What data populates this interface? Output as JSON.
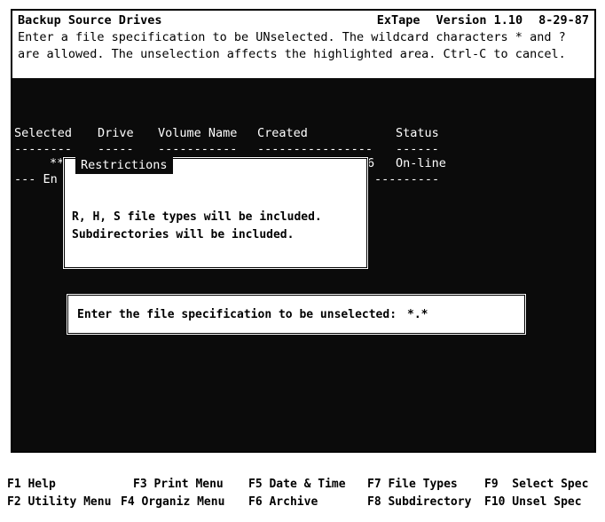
{
  "title": {
    "screen_name": "Backup Source Drives",
    "app_name": "ExTape",
    "version": "Version 1.10",
    "date": "8-29-87"
  },
  "instructions": [
    "Enter a file specification to be UNselected. The wildcard characters * and ?",
    "are allowed. The unselection affects the highlighted area. Ctrl-C to cancel."
  ],
  "table": {
    "headers": [
      "Selected",
      "Drive",
      "Volume Name",
      "Created",
      "Status"
    ],
    "dashes": [
      "--------",
      "-----",
      "-----------",
      "----------------",
      "------"
    ],
    "row": {
      "selected": "**",
      "fragment": "6",
      "status": "On-line"
    },
    "row2": {
      "prefix": "--- En",
      "dashes": "---------"
    }
  },
  "restrictions": {
    "title": "Restrictions",
    "lines": [
      "R, H, S file types will be included.",
      "Subdirectories will be included."
    ]
  },
  "spec_prompt": {
    "label": "Enter the file specification to be unselected:",
    "value": "*.*"
  },
  "function_keys": {
    "row1": [
      "F1 Help",
      "F3 Print Menu",
      "F5 Date & Time",
      "F7 File Types",
      "F9  Select Spec"
    ],
    "row2": [
      "F2 Utility Menu",
      "F4 Organiz Menu",
      "F6 Archive",
      "F8 Subdirectory",
      "F10 Unsel Spec"
    ]
  }
}
